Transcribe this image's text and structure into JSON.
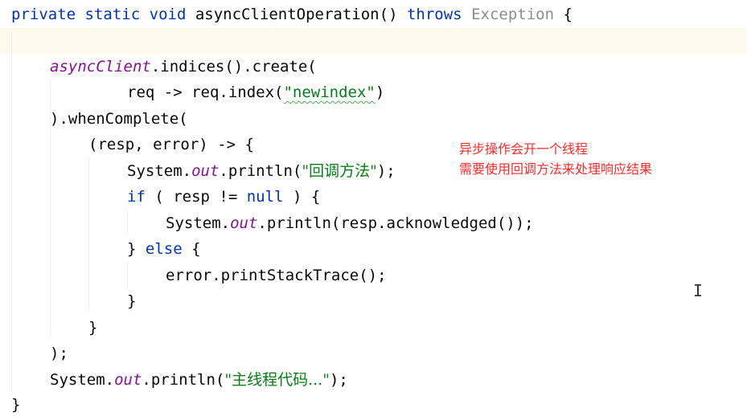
{
  "code": {
    "line1": {
      "kw_private": "private",
      "kw_static": "static",
      "kw_void": "void",
      "method_name": "asyncClientOperation",
      "params": "()",
      "kw_throws": "throws",
      "exception": "Exception",
      "brace_open": "{"
    },
    "line3": {
      "field": "asyncClient",
      "rest": ".indices().create("
    },
    "line4": {
      "pre": "req -> req.index(",
      "str": "\"newindex\"",
      "post": ")"
    },
    "line5": {
      "text": ").whenComplete("
    },
    "line6": {
      "text": "(resp, error) -> {"
    },
    "line7": {
      "pre": "System.",
      "field": "out",
      "mid": ".println(",
      "str": "\"回调方法\"",
      "post": ");"
    },
    "line8": {
      "kw_if": "if",
      "pre": " ( resp != ",
      "kw_null": "null",
      "post": " ) {"
    },
    "line9": {
      "pre": "System.",
      "field": "out",
      "post": ".println(resp.acknowledged());"
    },
    "line10": {
      "pre": "} ",
      "kw_else": "else",
      "post": " {"
    },
    "line11": {
      "text": "error.printStackTrace();"
    },
    "line12": {
      "text": "}"
    },
    "line13": {
      "text": "}"
    },
    "line14": {
      "text": ");"
    },
    "line15": {
      "pre": "System.",
      "field": "out",
      "mid": ".println(",
      "str": "\"主线程代码...\"",
      "post": ");"
    },
    "line16": {
      "text": "}"
    }
  },
  "annotation": {
    "line1": "异步操作会开一个线程",
    "line2": "需要使用回调方法来处理响应结果"
  },
  "colors": {
    "keyword": "#0033b3",
    "field": "#871094",
    "string": "#067d17",
    "annotation": "#ff2a2a",
    "current_line": "#fdfaed"
  },
  "icons": {
    "cursor": "text-cursor-icon"
  }
}
